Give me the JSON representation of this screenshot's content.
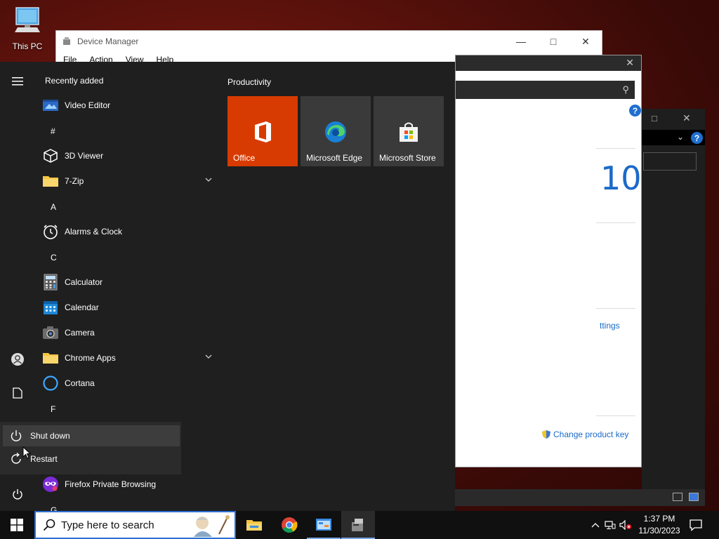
{
  "desktop": {
    "icons": [
      {
        "label": "This PC",
        "icon": "computer-icon"
      }
    ]
  },
  "device_manager": {
    "title": "Device Manager",
    "menu": [
      "File",
      "Action",
      "View",
      "Help"
    ]
  },
  "about_window": {
    "version_fragment": "10",
    "settings_fragment": "ttings",
    "change_key_label": "Change product key"
  },
  "start_menu": {
    "list_header": "Recently added",
    "apps": [
      {
        "label": "Video Editor",
        "icon": "video-editor-icon"
      },
      {
        "label": "3D Viewer",
        "icon": "cube-icon"
      },
      {
        "label": "7-Zip",
        "icon": "folder-icon",
        "expandable": true
      },
      {
        "label": "Alarms & Clock",
        "icon": "alarm-icon"
      },
      {
        "label": "Calculator",
        "icon": "calculator-icon"
      },
      {
        "label": "Calendar",
        "icon": "calendar-icon"
      },
      {
        "label": "Camera",
        "icon": "camera-icon"
      },
      {
        "label": "Chrome Apps",
        "icon": "folder-icon",
        "expandable": true
      },
      {
        "label": "Cortana",
        "icon": "cortana-icon"
      },
      {
        "label": "Firefox Private Browsing",
        "icon": "firefox-private-icon"
      }
    ],
    "letters": [
      "#",
      "A",
      "C",
      "F",
      "G"
    ],
    "tiles_group": "Productivity",
    "tiles": [
      {
        "label": "Office",
        "color": "#d83b01",
        "icon": "office-icon"
      },
      {
        "label": "Microsoft Edge",
        "color": "#3a3a3a",
        "icon": "edge-icon"
      },
      {
        "label": "Microsoft Store",
        "color": "#3a3a3a",
        "icon": "store-icon"
      }
    ],
    "power_menu": {
      "items": [
        {
          "label": "Shut down",
          "icon": "power-icon"
        },
        {
          "label": "Restart",
          "icon": "restart-icon"
        }
      ]
    }
  },
  "taskbar": {
    "search_placeholder": "Type here to search",
    "pinned": [
      "file-explorer-icon",
      "chrome-icon",
      "control-panel-icon",
      "device-manager-icon"
    ],
    "time": "1:37 PM",
    "date": "11/30/2023"
  },
  "colors": {
    "accent": "#2c6fd3",
    "office_tile": "#d83b01",
    "start_bg": "#1f1f1f"
  }
}
